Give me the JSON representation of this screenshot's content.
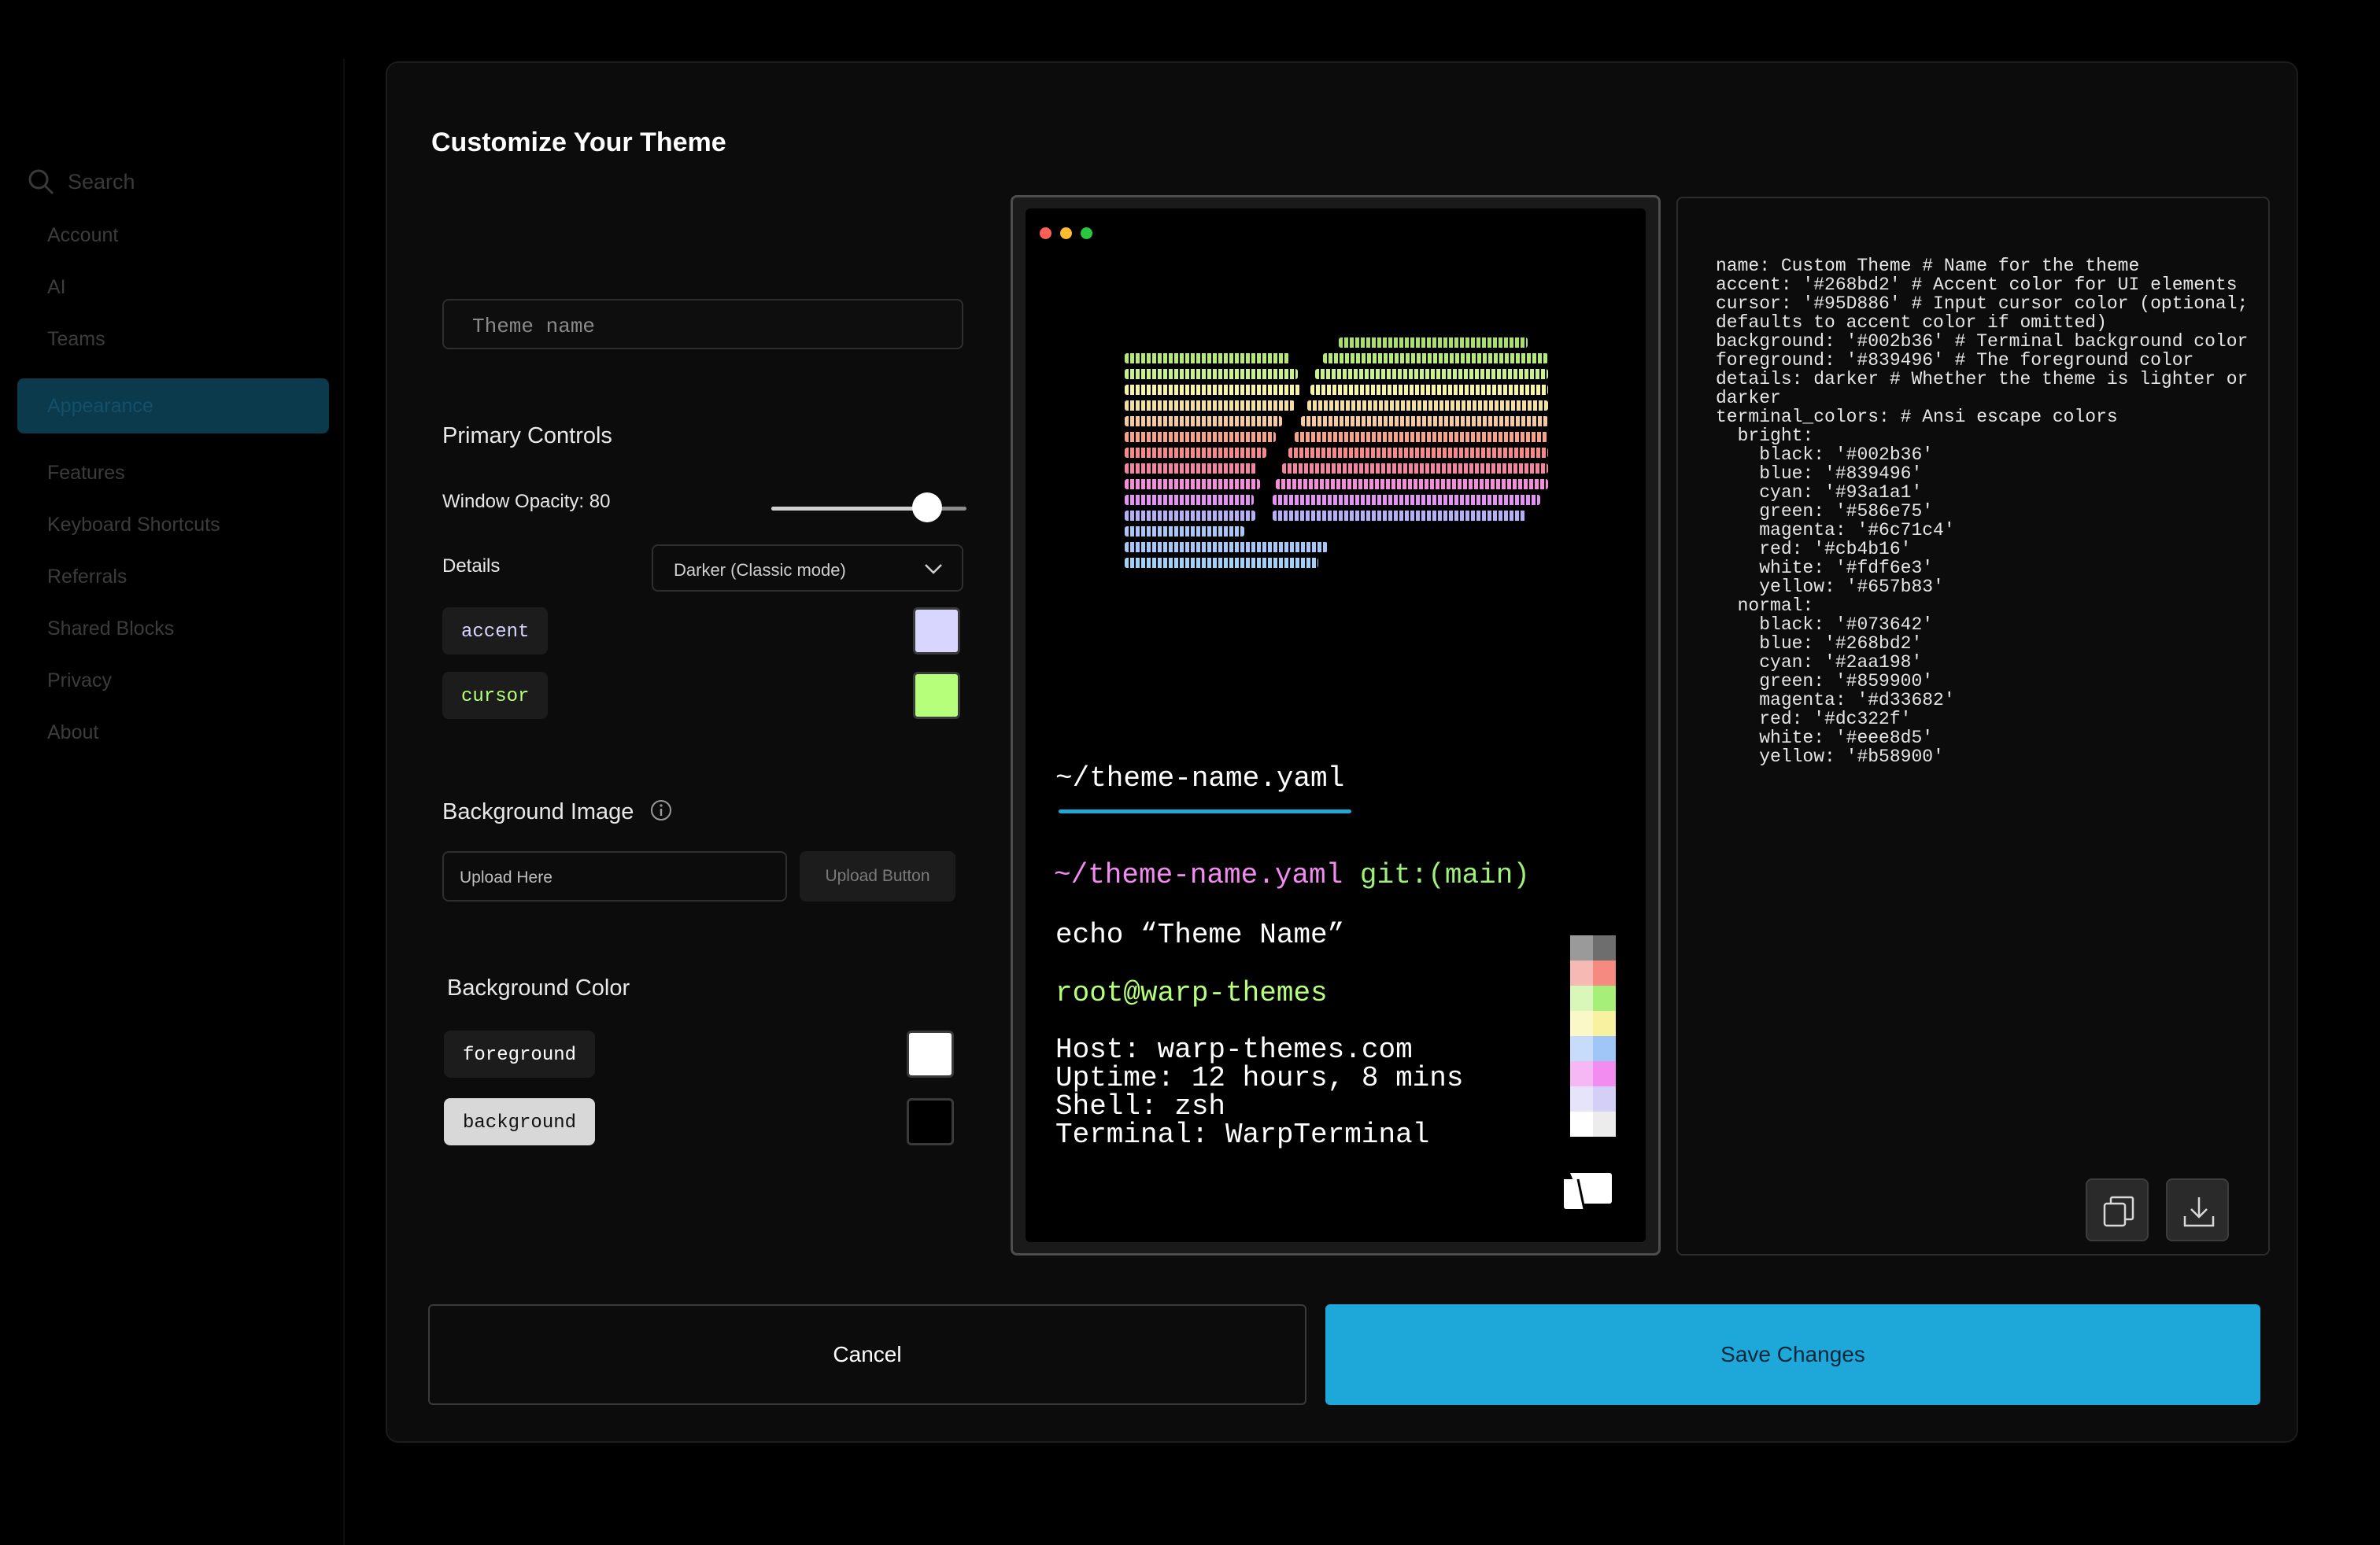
{
  "sidebar": {
    "search_label": "Search",
    "items": [
      {
        "label": "Account"
      },
      {
        "label": "AI"
      },
      {
        "label": "Teams"
      },
      {
        "label": "Appearance",
        "active": true
      },
      {
        "label": "Features"
      },
      {
        "label": "Keyboard Shortcuts"
      },
      {
        "label": "Referrals"
      },
      {
        "label": "Shared Blocks"
      },
      {
        "label": "Privacy"
      },
      {
        "label": "About"
      }
    ]
  },
  "modal": {
    "title": "Customize Your Theme",
    "theme_name_placeholder": "Theme name",
    "primary_controls": {
      "heading": "Primary Controls",
      "opacity_label": "Window Opacity: 80",
      "opacity_value": 0.8,
      "details_label": "Details",
      "details_value": "Darker (Classic mode)",
      "accent_label": "accent",
      "accent_color": "#d8d6ff",
      "cursor_label": "cursor",
      "cursor_color": "#b6ff7a"
    },
    "background_image": {
      "heading": "Background Image",
      "upload_placeholder": "Upload Here",
      "upload_button": "Upload Button"
    },
    "background_color": {
      "heading": "Background Color",
      "foreground_label": "foreground",
      "foreground_color": "#ffffff",
      "background_label": "background",
      "background_color": "#000000"
    },
    "terminal": {
      "tab_file": "~/theme-name.yaml",
      "prompt_path": "~/theme-name.yaml",
      "prompt_git": "git:(main)",
      "command": "echo “Theme Name”",
      "user_host": "root@warp-themes",
      "host_line": "Host: warp-themes.com",
      "uptime_line": "Uptime: 12 hours, 8 mins",
      "shell_line": "Shell: zsh",
      "terminal_line": "Terminal: WarpTerminal"
    },
    "yaml": "name: Custom Theme # Name for the theme\naccent: '#268bd2' # Accent color for UI elements\ncursor: '#95D886' # Input cursor color (optional; defaults to accent color if omitted)\nbackground: '#002b36' # Terminal background color\nforeground: '#839496' # The foreground color\ndetails: darker # Whether the theme is lighter or darker\nterminal_colors: # Ansi escape colors\n  bright:\n    black: '#002b36'\n    blue: '#839496'\n    cyan: '#93a1a1'\n    green: '#586e75'\n    magenta: '#6c71c4'\n    red: '#cb4b16'\n    white: '#fdf6e3'\n    yellow: '#657b83'\n  normal:\n    black: '#073642'\n    blue: '#268bd2'\n    cyan: '#2aa198'\n    green: '#859900'\n    magenta: '#d33682'\n    red: '#dc322f'\n    white: '#eee8d5'\n    yellow: '#b58900'",
    "cancel_label": "Cancel",
    "save_label": "Save Changes"
  },
  "colors": {
    "save_button": "#1da8d9",
    "prompt_path": "#f28bf0",
    "prompt_git": "#9ef07a",
    "user_host": "#b6ff7a"
  }
}
